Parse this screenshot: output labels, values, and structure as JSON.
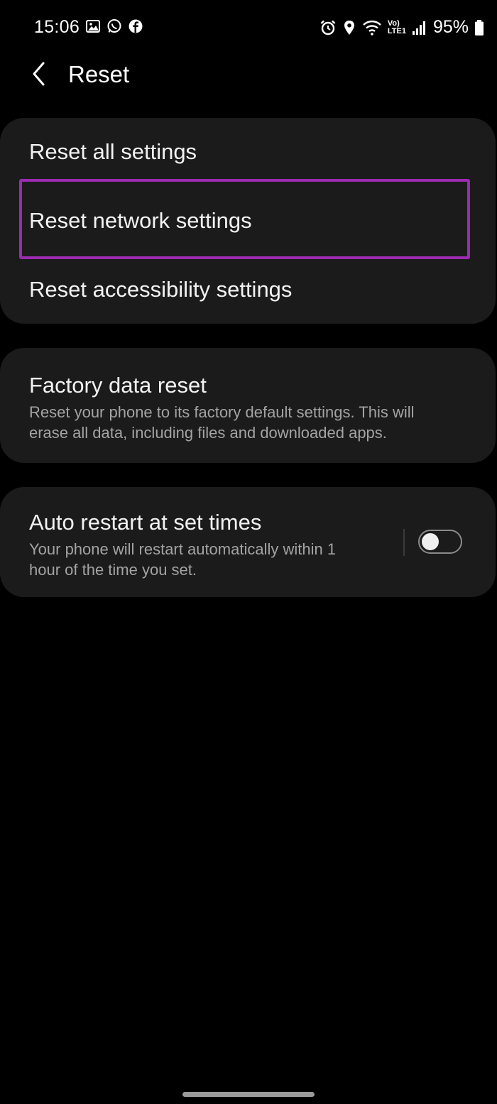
{
  "status_bar": {
    "time": "15:06",
    "left_icons": [
      "gallery-icon",
      "whatsapp-icon",
      "facebook-icon"
    ],
    "right_icons": [
      "alarm-icon",
      "location-icon",
      "wifi-icon",
      "volte-icon",
      "signal-icon",
      "battery-icon"
    ],
    "volte_label_top": "Vo)",
    "volte_label_bottom": "LTE1",
    "battery": "95%"
  },
  "header": {
    "back_icon": "chevron-left-icon",
    "title": "Reset"
  },
  "groups": [
    {
      "items": [
        {
          "title": "Reset all settings"
        },
        {
          "title": "Reset network settings",
          "highlighted": true
        },
        {
          "title": "Reset accessibility settings"
        }
      ]
    },
    {
      "items": [
        {
          "title": "Factory data reset",
          "description_line1": "Reset your phone to its factory default settings. This will",
          "description_line2": "erase all data, including files and downloaded apps."
        }
      ]
    },
    {
      "items": [
        {
          "title": "Auto restart at set times",
          "description_line1": "Your phone will restart automatically within 1",
          "description_line2": "hour of the time you set.",
          "toggle_on": false
        }
      ]
    }
  ],
  "colors": {
    "background": "#000000",
    "card": "#1b1b1b",
    "highlight": "#9b2bb0",
    "secondary_text": "#a3a3a3"
  }
}
